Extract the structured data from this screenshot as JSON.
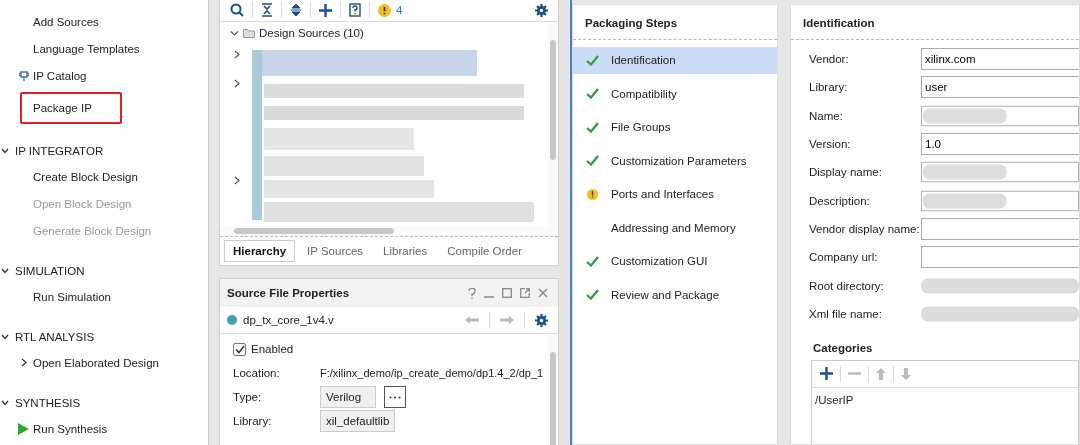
{
  "flow_navigator": {
    "sections": [
      {
        "items": [
          {
            "label": "Add Sources",
            "kind": "plain",
            "disabled": false,
            "highlighted": false
          },
          {
            "label": "Language Templates",
            "kind": "plain",
            "disabled": false,
            "highlighted": false
          },
          {
            "label": "IP Catalog",
            "kind": "ip",
            "disabled": false,
            "highlighted": false
          },
          {
            "label": "Package IP",
            "kind": "plain",
            "disabled": false,
            "highlighted": true
          }
        ]
      },
      {
        "title": "IP INTEGRATOR",
        "items": [
          {
            "label": "Create Block Design",
            "kind": "plain",
            "disabled": false,
            "highlighted": false
          },
          {
            "label": "Open Block Design",
            "kind": "plain",
            "disabled": true,
            "highlighted": false
          },
          {
            "label": "Generate Block Design",
            "kind": "plain",
            "disabled": true,
            "highlighted": false
          }
        ]
      },
      {
        "title": "SIMULATION",
        "items": [
          {
            "label": "Run Simulation",
            "kind": "plain",
            "disabled": false,
            "highlighted": false
          }
        ]
      },
      {
        "title": "RTL ANALYSIS",
        "items": [
          {
            "label": "Open Elaborated Design",
            "kind": "expand",
            "disabled": false,
            "highlighted": false
          }
        ]
      },
      {
        "title": "SYNTHESIS",
        "items": [
          {
            "label": "Run Synthesis",
            "kind": "run",
            "disabled": false,
            "highlighted": false
          }
        ]
      }
    ]
  },
  "sources": {
    "warning_count": "4",
    "tree": {
      "label": "Design Sources (10)",
      "expanded": true
    },
    "tabs": [
      {
        "label": "Hierarchy",
        "selected": true
      },
      {
        "label": "IP Sources",
        "selected": false
      },
      {
        "label": "Libraries",
        "selected": false
      },
      {
        "label": "Compile Order",
        "selected": false
      }
    ]
  },
  "properties": {
    "title": "Source File Properties",
    "file": "dp_tx_core_1v4.v",
    "enabled": {
      "label": "Enabled",
      "checked": true
    },
    "location": {
      "label": "Location:",
      "value": "F:/xilinx_demo/ip_create_demo/dp1.4_2/dp_1"
    },
    "type": {
      "label": "Type:",
      "value": "Verilog"
    },
    "library": {
      "label": "Library:",
      "value": "xil_defaultlib"
    }
  },
  "packaging_steps": {
    "title": "Packaging Steps",
    "steps": [
      {
        "label": "Identification",
        "complete": true,
        "warning": false,
        "selected": true
      },
      {
        "label": "Compatibility",
        "complete": true,
        "warning": false,
        "selected": false
      },
      {
        "label": "File Groups",
        "complete": true,
        "warning": false,
        "selected": false
      },
      {
        "label": "Customization Parameters",
        "complete": true,
        "warning": false,
        "selected": false
      },
      {
        "label": "Ports and Interfaces",
        "complete": false,
        "warning": true,
        "selected": false
      },
      {
        "label": "Addressing and Memory",
        "complete": false,
        "warning": false,
        "selected": false
      },
      {
        "label": "Customization GUI",
        "complete": true,
        "warning": false,
        "selected": false
      },
      {
        "label": "Review and Package",
        "complete": true,
        "warning": false,
        "selected": false
      }
    ]
  },
  "identification": {
    "title": "Identification",
    "fields": [
      {
        "label": "Vendor:",
        "kind": "input",
        "value": "xilinx.com"
      },
      {
        "label": "Library:",
        "kind": "input",
        "value": "user"
      },
      {
        "label": "Name:",
        "kind": "blurred"
      },
      {
        "label": "Version:",
        "kind": "input",
        "value": "1.0"
      },
      {
        "label": "Display name:",
        "kind": "blurred"
      },
      {
        "label": "Description:",
        "kind": "blurred"
      },
      {
        "label": "Vendor display name:",
        "kind": "input"
      },
      {
        "label": "Company url:",
        "kind": "input"
      },
      {
        "label": "Root directory:",
        "kind": "blurred-text"
      },
      {
        "label": "Xml file name:",
        "kind": "blurred-text"
      }
    ],
    "categories": {
      "title": "Categories",
      "items": [
        "/UserIP"
      ]
    }
  }
}
